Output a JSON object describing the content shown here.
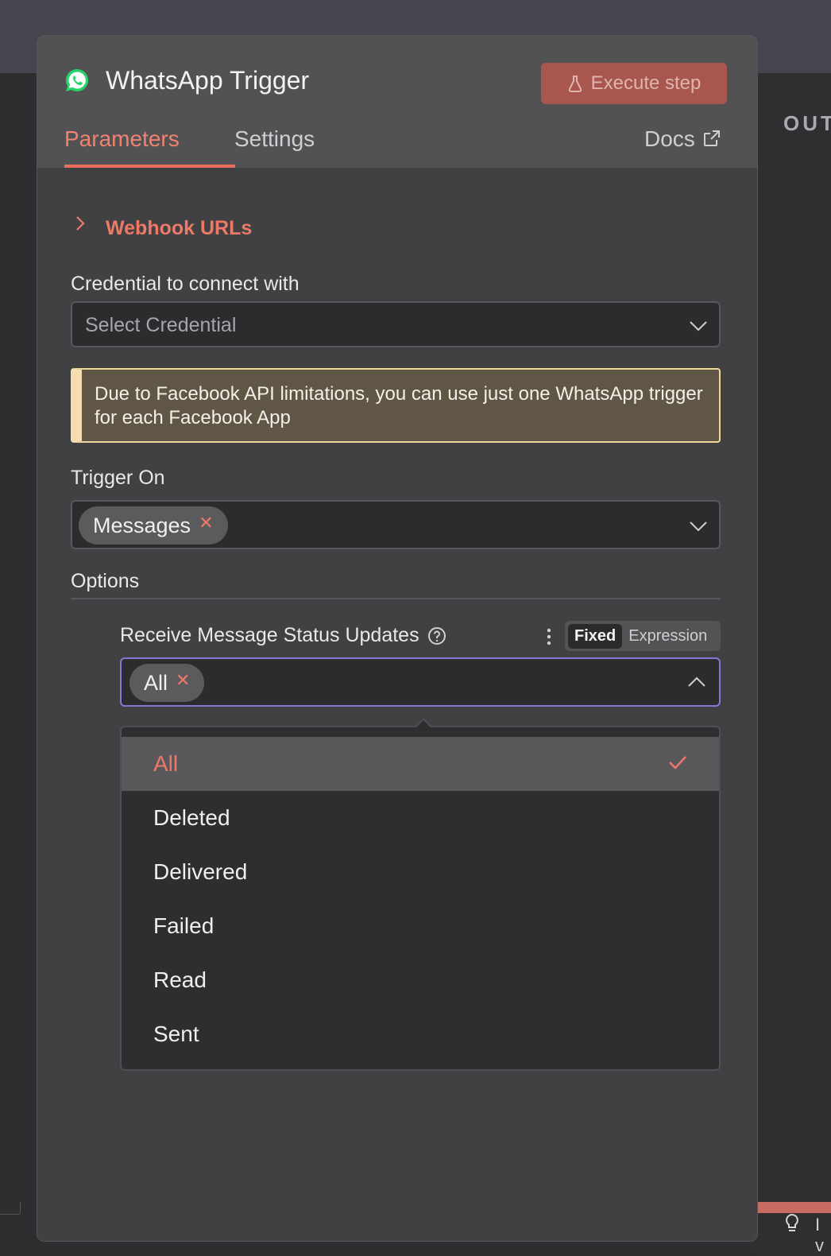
{
  "panel": {
    "title": "WhatsApp Trigger",
    "execute_label": "Execute step",
    "tabs": [
      {
        "label": "Parameters",
        "active": true
      },
      {
        "label": "Settings",
        "active": false
      }
    ],
    "docs_label": "Docs"
  },
  "right_panel": {
    "label": "OUT"
  },
  "footer": {
    "text": "I v"
  },
  "webhook": {
    "label": "Webhook URLs"
  },
  "credential": {
    "label": "Credential to connect with",
    "placeholder": "Select Credential"
  },
  "notice": {
    "text": "Due to Facebook API limitations, you can use just one WhatsApp trigger for each Facebook App"
  },
  "trigger_on": {
    "label": "Trigger On",
    "chips": [
      "Messages"
    ]
  },
  "options": {
    "label": "Options",
    "status_updates": {
      "label": "Receive Message Status Updates",
      "mode_fixed": "Fixed",
      "mode_expression": "Expression",
      "chips": [
        "All"
      ]
    }
  },
  "dropdown": {
    "items": [
      {
        "label": "All",
        "selected": true
      },
      {
        "label": "Deleted",
        "selected": false
      },
      {
        "label": "Delivered",
        "selected": false
      },
      {
        "label": "Failed",
        "selected": false
      },
      {
        "label": "Read",
        "selected": false
      },
      {
        "label": "Sent",
        "selected": false
      }
    ]
  },
  "colors": {
    "accent": "#EA6E5E",
    "whatsapp": "#25D366",
    "notice_border": "#F0D79B",
    "focus": "#8677D8"
  },
  "icons": {
    "app": "whatsapp-icon",
    "execute": "flask-icon",
    "docs": "external-link-icon",
    "webhook_toggle": "chevron-right-icon",
    "help": "question-circle-icon",
    "menu": "vertical-dots-icon",
    "select_open": "chevron-up-icon",
    "select_closed": "chevron-down-icon",
    "selected": "check-icon",
    "remove": "close-icon"
  }
}
